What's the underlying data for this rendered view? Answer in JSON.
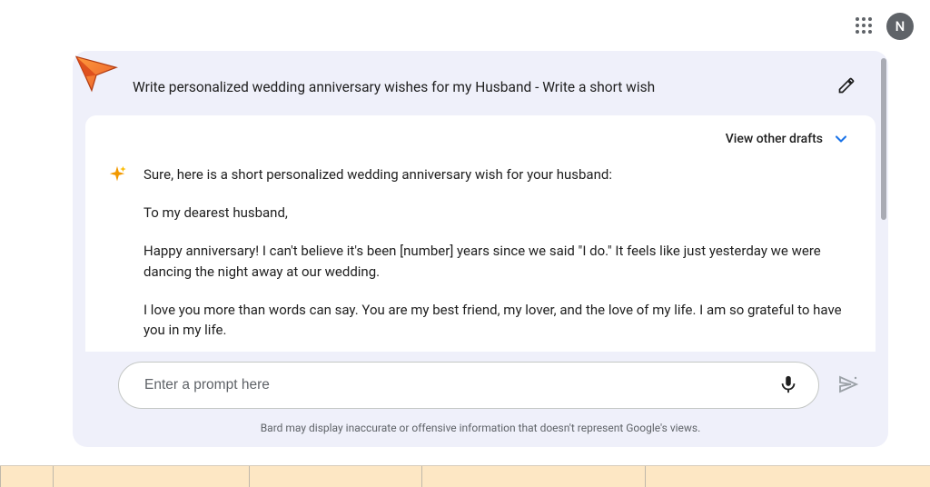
{
  "topbar": {
    "avatar_initial": "N"
  },
  "header": {
    "prompt_title": "Write personalized wedding anniversary wishes for my Husband - Write a short wish"
  },
  "response": {
    "view_drafts_label": "View other drafts",
    "intro": "Sure, here is a short personalized wedding anniversary wish for your husband:",
    "p1": "To my dearest husband,",
    "p2": "Happy anniversary! I can't believe it's been [number] years since we said \"I do.\" It feels like just yesterday we were dancing the night away at our wedding.",
    "p3": "I love you more than words can say. You are my best friend, my lover, and the love of my life. I am so grateful to have you in my life."
  },
  "input": {
    "placeholder": "Enter a prompt here"
  },
  "footer": {
    "disclaimer": "Bard may display inaccurate or offensive information that doesn't represent Google's views."
  }
}
